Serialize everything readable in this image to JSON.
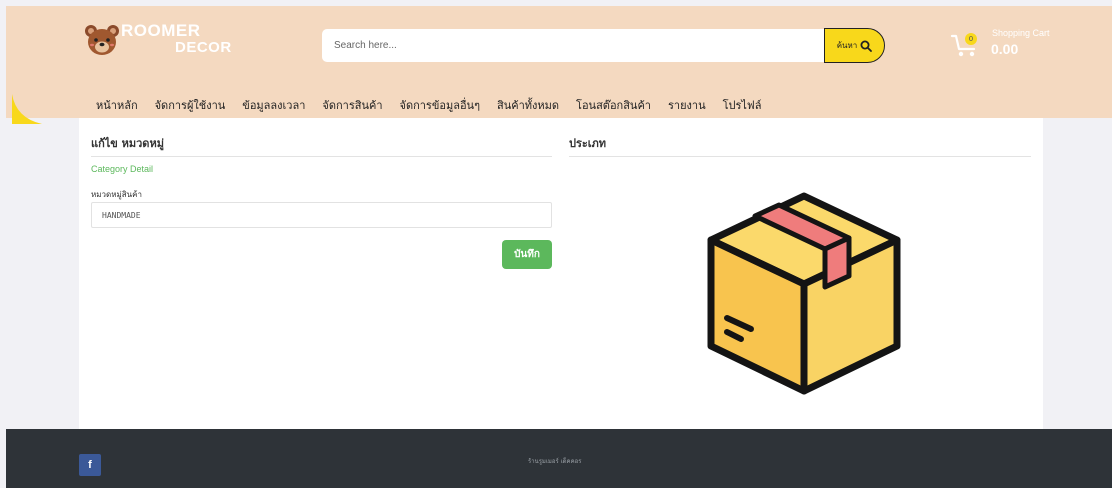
{
  "brand": {
    "line1": "ROOMER",
    "line2": "DECOR",
    "logo_icon": "bear-icon"
  },
  "search": {
    "placeholder": "Search here...",
    "button_label": "ค้นหา",
    "icon": "search-icon"
  },
  "cart": {
    "label": "Shopping Cart",
    "total": "0.00",
    "count": "0",
    "icon": "cart-icon"
  },
  "nav": {
    "items": [
      {
        "label": "หน้าหลัก"
      },
      {
        "label": "จัดการผู้ใช้งาน"
      },
      {
        "label": "ข้อมูลลงเวลา"
      },
      {
        "label": "จัดการสินค้า"
      },
      {
        "label": "จัดการข้อมูลอื่นๆ"
      },
      {
        "label": "สินค้าทั้งหมด"
      },
      {
        "label": "โอนสต๊อกสินค้า"
      },
      {
        "label": "รายงาน"
      },
      {
        "label": "โปรไฟล์"
      }
    ]
  },
  "form": {
    "title": "แก้ไข หมวดหมู่",
    "subtitle": "Category Detail",
    "field_label": "หมวดหมู่สินค้า",
    "field_value": "HANDMADE",
    "save_label": "บันทึก"
  },
  "preview": {
    "title": "ประเภท",
    "icon": "box-icon"
  },
  "footer": {
    "text": "ร้านรูมเมอร์ เด็คคอร",
    "social_icon": "facebook-icon",
    "social_glyph": "f"
  },
  "colors": {
    "header_bg": "#f4d9c0",
    "accent_yellow": "#f8d81b",
    "save_green": "#5cb85c",
    "footer_bg": "#2e3338",
    "facebook_blue": "#3b5998"
  }
}
